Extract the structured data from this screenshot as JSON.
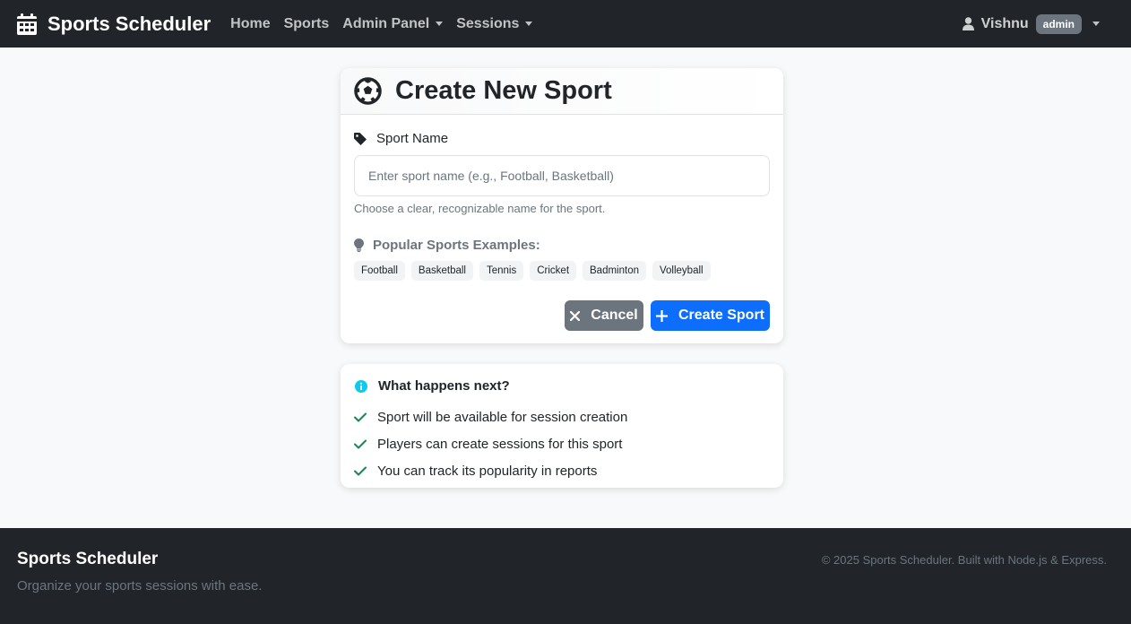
{
  "navbar": {
    "brand": "Sports Scheduler",
    "brand_icon": "calendar-icon",
    "links": [
      {
        "label": "Home",
        "dropdown": false
      },
      {
        "label": "Sports",
        "dropdown": false
      },
      {
        "label": "Admin Panel",
        "dropdown": true
      },
      {
        "label": "Sessions",
        "dropdown": true
      }
    ],
    "user": {
      "name": "Vishnu",
      "role_badge": "admin"
    }
  },
  "form": {
    "title": "Create New Sport",
    "title_icon": "soccer-ball-icon",
    "sport_name_label": "Sport Name",
    "sport_name_value": "",
    "sport_name_placeholder": "Enter sport name (e.g., Football, Basketball)",
    "sport_name_help": "Choose a clear, recognizable name for the sport.",
    "examples_title": "Popular Sports Examples:",
    "examples": [
      "Football",
      "Basketball",
      "Tennis",
      "Cricket",
      "Badminton",
      "Volleyball"
    ],
    "cancel_label": "Cancel",
    "create_label": "Create Sport"
  },
  "info": {
    "title": "What happens next?",
    "items": [
      "Sport will be available for session creation",
      "Players can create sessions for this sport",
      "You can track its popularity in reports"
    ]
  },
  "footer": {
    "title": "Sports Scheduler",
    "tagline": "Organize your sports sessions with ease.",
    "copyright": "© 2025 Sports Scheduler. Built with Node.js & Express."
  },
  "colors": {
    "navbar_bg": "#212529",
    "primary": "#0d6efd",
    "secondary": "#6c757d",
    "info": "#0dcaf0",
    "success": "#198754"
  }
}
